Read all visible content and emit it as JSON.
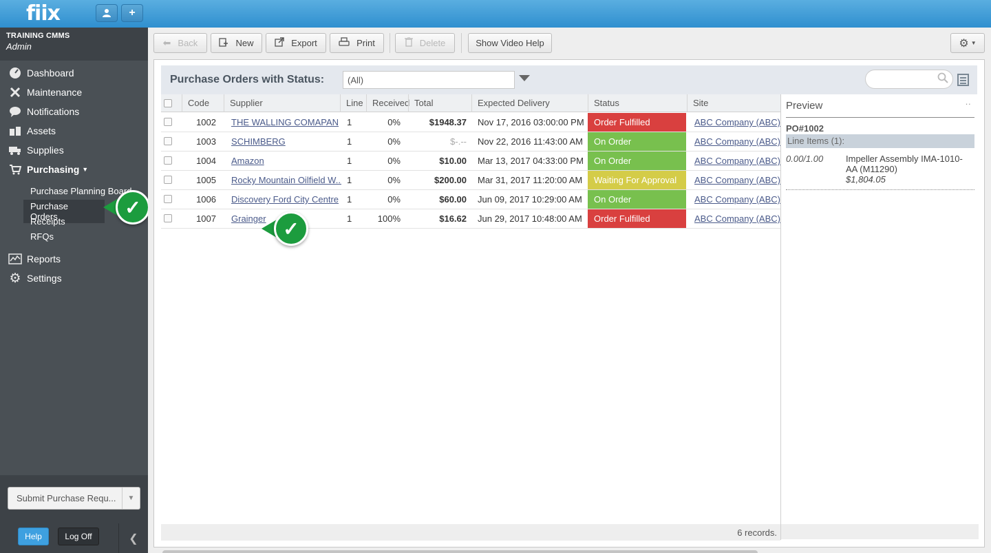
{
  "app": {
    "logo": "fiix"
  },
  "topbar": {
    "user_icon": "user-icon",
    "add_icon": "plus-icon"
  },
  "sidebar": {
    "org_name": "TRAINING CMMS",
    "role": "Admin",
    "nav": [
      {
        "label": "Dashboard",
        "icon": "dashboard-icon"
      },
      {
        "label": "Maintenance",
        "icon": "tools-icon"
      },
      {
        "label": "Notifications",
        "icon": "speech-bubble-icon"
      },
      {
        "label": "Assets",
        "icon": "boxes-icon"
      },
      {
        "label": "Supplies",
        "icon": "truck-icon"
      },
      {
        "label": "Purchasing",
        "icon": "cart-icon"
      },
      {
        "label": "Reports",
        "icon": "chart-icon"
      },
      {
        "label": "Settings",
        "icon": "gear-icon"
      }
    ],
    "purchasing_sub": [
      "Purchase Planning Board",
      "Purchase Orders",
      "Receipts",
      "RFQs"
    ],
    "submit_label": "Submit Purchase Requ...",
    "help_label": "Help",
    "logoff_label": "Log Off"
  },
  "toolbar": {
    "back": "Back",
    "new": "New",
    "export": "Export",
    "print": "Print",
    "delete": "Delete",
    "video_help": "Show Video Help"
  },
  "panel": {
    "title": "Purchase Orders with Status:",
    "status_value": "(All)",
    "search_placeholder": ""
  },
  "table": {
    "columns": [
      "Code",
      "Supplier",
      "Line",
      "Received",
      "Total",
      "Expected Delivery",
      "Status",
      "Site"
    ],
    "rows": [
      {
        "code": "1002",
        "supplier": "THE WALLING COMAPANY",
        "line": "1",
        "received": "0%",
        "total": "$1948.37",
        "delivery": "Nov 17, 2016 03:00:00 PM",
        "status": "Order Fulfilled",
        "status_color": "#d9403f",
        "site": "ABC Company (ABC)"
      },
      {
        "code": "1003",
        "supplier": "SCHIMBERG",
        "line": "1",
        "received": "0%",
        "total": "$-.--",
        "delivery": "Nov 22, 2016 11:43:00 AM",
        "status": "On Order",
        "status_color": "#78c04e",
        "site": "ABC Company (ABC)"
      },
      {
        "code": "1004",
        "supplier": "Amazon",
        "line": "1",
        "received": "0%",
        "total": "$10.00",
        "delivery": "Mar 13, 2017 04:33:00 PM",
        "status": "On Order",
        "status_color": "#78c04e",
        "site": "ABC Company (ABC)"
      },
      {
        "code": "1005",
        "supplier": "Rocky Mountain Oilfield W...",
        "line": "1",
        "received": "0%",
        "total": "$200.00",
        "delivery": "Mar 31, 2017 11:20:00 AM",
        "status": "Waiting For Approval",
        "status_color": "#d4cc48",
        "site": "ABC Company (ABC)"
      },
      {
        "code": "1006",
        "supplier": "Discovery Ford City Centre",
        "line": "1",
        "received": "0%",
        "total": "$60.00",
        "delivery": "Jun 09, 2017 10:29:00 AM",
        "status": "On Order",
        "status_color": "#78c04e",
        "site": "ABC Company (ABC)"
      },
      {
        "code": "1007",
        "supplier": "Grainger",
        "line": "1",
        "received": "100%",
        "total": "$16.62",
        "delivery": "Jun 29, 2017 10:48:00 AM",
        "status": "Order Fulfilled",
        "status_color": "#d9403f",
        "site": "ABC Company (ABC)"
      }
    ],
    "records_text": "6 records."
  },
  "preview": {
    "title": "Preview",
    "dots": "··",
    "po_number": "PO#1002",
    "line_items_label": "Line Items (1):",
    "item_qty": "0.00/1.00",
    "item_desc": "Impeller Assembly IMA-1010-AA (M11290)",
    "item_price": "$1,804.05"
  }
}
